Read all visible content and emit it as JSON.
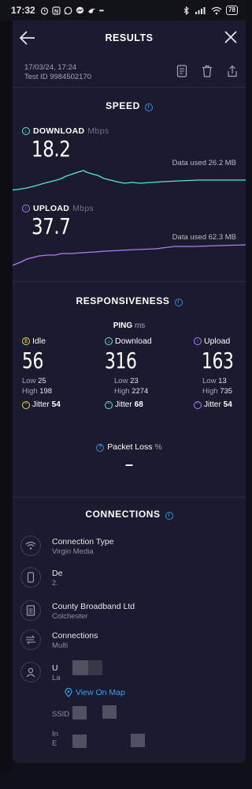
{
  "status_bar": {
    "time": "17:32",
    "battery": "78",
    "icons": [
      "alarm-icon",
      "app-icon",
      "whatsapp-icon",
      "messenger-icon",
      "bird-icon",
      "more-dots-icon",
      "bluetooth-icon",
      "signal-icon",
      "wifi-icon",
      "battery-icon"
    ],
    "more": "•••"
  },
  "header": {
    "title": "RESULTS",
    "back_icon": "back-arrow-icon",
    "close_icon": "close-icon"
  },
  "meta": {
    "datetime": "17/03/24, 17:24",
    "test_id": "Test ID 9984502170",
    "actions": [
      "results-list-icon",
      "trash-icon",
      "share-icon"
    ]
  },
  "speed": {
    "title": "SPEED",
    "download": {
      "label": "DOWNLOAD",
      "unit": "Mbps",
      "value": "18.2",
      "data_used": "Data used 26.2 MB",
      "color": "#5fe1e0"
    },
    "upload": {
      "label": "UPLOAD",
      "unit": "Mbps",
      "value": "37.7",
      "data_used": "Data used 62.3 MB",
      "color": "#b27cf5"
    }
  },
  "responsiveness": {
    "title": "RESPONSIVENESS",
    "ping_label": "PING",
    "ping_unit": "ms",
    "columns": [
      {
        "label": "Idle",
        "value": "56",
        "low_label": "Low",
        "low": "25",
        "high_label": "High",
        "high": "198",
        "jitter_label": "Jitter",
        "jitter": "54",
        "color": "#e8d44a"
      },
      {
        "label": "Download",
        "value": "316",
        "low_label": "Low",
        "low": "23",
        "high_label": "High",
        "high": "2274",
        "jitter_label": "Jitter",
        "jitter": "68",
        "color": "#5fe1e0"
      },
      {
        "label": "Upload",
        "value": "163",
        "low_label": "Low",
        "low": "13",
        "high_label": "High",
        "high": "735",
        "jitter_label": "Jitter",
        "jitter": "54",
        "color": "#b27cf5"
      }
    ],
    "packet_loss_label": "Packet Loss",
    "packet_loss_unit": "%",
    "packet_loss_value": "–"
  },
  "connections": {
    "title": "CONNECTIONS",
    "items": [
      {
        "icon": "connection-type-icon",
        "title": "Connection Type",
        "sub": "Virgin Media"
      },
      {
        "icon": "device-icon",
        "title": "De",
        "sub": "2."
      },
      {
        "icon": "server-icon",
        "title": "County Broadband Ltd",
        "sub": "Colchester"
      },
      {
        "icon": "connections-icon",
        "title": "Connections",
        "sub": "Multi"
      },
      {
        "icon": "user-icon",
        "title": "U",
        "sub": "La"
      }
    ],
    "view_on_map": "View On Map",
    "ssid_label": "SSID",
    "internal_label_1": "In",
    "internal_label_2": "E"
  },
  "accent": "#3a8de0"
}
